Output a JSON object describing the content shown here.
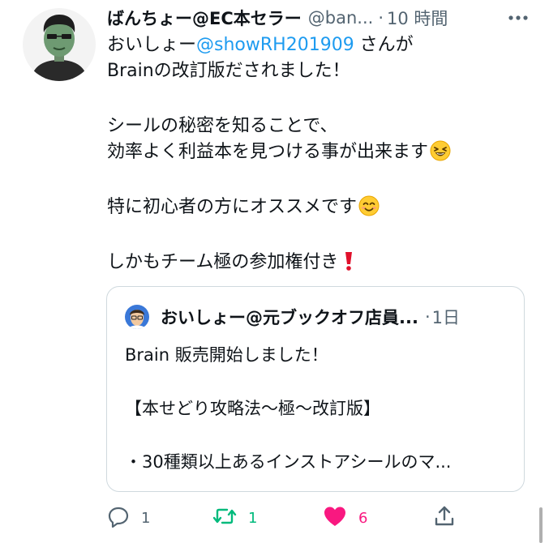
{
  "tweet": {
    "display_name": "ばんちょー@EC本セラー",
    "handle": "@ban...",
    "separator": "·",
    "time": "10 時間",
    "body": {
      "line1_prefix": "おいしょー",
      "mention": "@showRH201909",
      "line1_suffix": " さんが",
      "line2": "Brainの改訂版だされました！",
      "line3": "シールの秘密を知ることで、",
      "line4": "効率よく利益本を見つける事が出来ます",
      "line5": "特に初心者の方にオススメです",
      "line6": "しかもチーム極の参加権付き"
    },
    "emojis": {
      "line4": "grinning-squinting-face",
      "line5": "smiling-face-with-smiling-eyes",
      "line6": "red-exclamation-mark"
    }
  },
  "quote": {
    "display_name": "おいしょー@元ブックオフ店員...",
    "separator": "·",
    "time": "1日",
    "body": {
      "line1": "Brain 販売開始しました！",
      "line2": "【本せどり攻略法〜極〜改訂版】",
      "line3": "・30種類以上あるインストアシールのマ..."
    }
  },
  "actions": {
    "reply_count": "1",
    "retweet_count": "1",
    "like_count": "6"
  },
  "colors": {
    "link": "#1d9bf0",
    "secondary_text": "#536471",
    "retweet_active": "#00ba7c",
    "like_active": "#f91880",
    "border": "#cfd9de"
  }
}
